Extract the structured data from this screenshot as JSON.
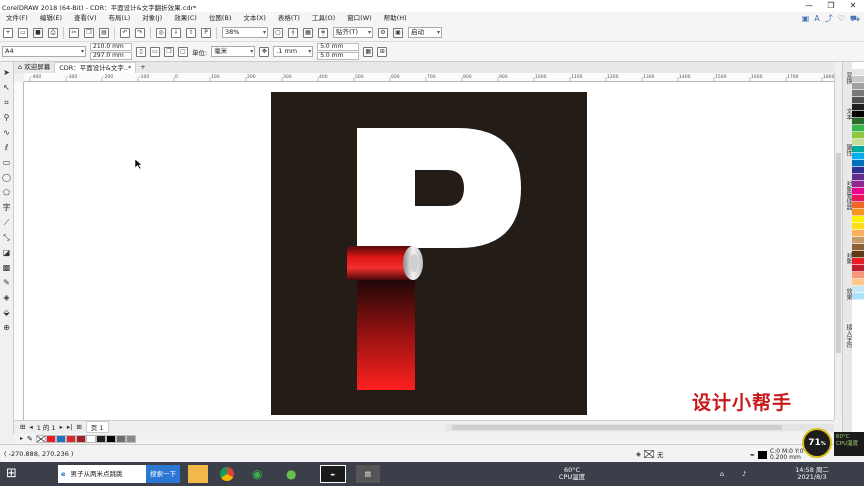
{
  "window": {
    "title": "CorelDRAW 2018 (64-Bit) - CDR：平面设计&文字翻折效果.cdr*",
    "controls": [
      "—",
      "❐",
      "✕"
    ]
  },
  "menu": {
    "items": [
      "文件(F)",
      "编辑(E)",
      "查看(V)",
      "布局(L)",
      "对象(J)",
      "效果(C)",
      "位图(B)",
      "文本(X)",
      "表格(T)",
      "工具(O)",
      "窗口(W)",
      "帮助(H)"
    ]
  },
  "toolbar": {
    "zoom": "38%",
    "snap_label": "贴齐(T)",
    "launch_label": "启动"
  },
  "propertybar": {
    "paper": "A4",
    "width": "210.0 mm",
    "height": "297.0 mm",
    "units_label": "单位:",
    "units": "毫米",
    "nudge": ".1 mm",
    "dup_x": "5.0 mm",
    "dup_y": "5.0 mm"
  },
  "tabs": [
    {
      "label": "欢迎屏幕"
    },
    {
      "label": "CDR：平面设计&文字..*"
    }
  ],
  "ruler": {
    "ticks": [
      "-400",
      "-300",
      "-200",
      "-100",
      "0",
      "100",
      "200",
      "300",
      "400",
      "500",
      "600",
      "700",
      "800",
      "900",
      "1000",
      "1100",
      "1200",
      "1300",
      "1400",
      "1500",
      "1600",
      "1700",
      "1800"
    ]
  },
  "watermark": "设计小帮手",
  "dockers": [
    "变换",
    "文本",
    "属性",
    "对象管理器",
    "对象",
    "效果",
    "插入字符"
  ],
  "palette": [
    "#ffffff",
    "#e6e6e6",
    "#c8c8c8",
    "#a0a0a0",
    "#787878",
    "#505050",
    "#1e1e1e",
    "#000000",
    "#2a6a2a",
    "#39b54a",
    "#8dc63f",
    "#c4df9b",
    "#00a99d",
    "#00aeef",
    "#0072bc",
    "#2e3192",
    "#662d91",
    "#92278f",
    "#ec008c",
    "#ed145b",
    "#f26522",
    "#f7941d",
    "#fff200",
    "#ffde17",
    "#fbaf5d",
    "#c69c6d",
    "#8c6239",
    "#603913",
    "#ed1c24",
    "#be1e2d",
    "#f7977a",
    "#fdc68a",
    "#c6e6f8",
    "#abe1fa"
  ],
  "pagebar": {
    "page_info": "1 的 1",
    "page_tab": "页 1"
  },
  "doc_palette": [
    "#ed1c24",
    "#1c75bc",
    "#d7282f",
    "#9e1f24",
    "#ffffff",
    "#231f20",
    "#000000",
    "#6d6e71",
    "#8a8a8a"
  ],
  "statusbar": {
    "coords": "( -270.888, 270.236 )",
    "fill_label": "无",
    "stroke_label": "C:0 M:0 Y:0 K:100",
    "stroke_size": "0.200 mm"
  },
  "taskbar": {
    "search_text": "男子从两米点跳跳",
    "search_button": "搜索一下",
    "cpu_temp": "60°C",
    "cpu_label": "CPU温度",
    "time": "14:58 周二",
    "date": "2021/8/3"
  },
  "gauge": {
    "value": "71",
    "unit": "%"
  },
  "netwidget": {
    "line1": "60°C",
    "line2": "CPU温度"
  },
  "colors": {
    "artboard_bg": "#231c17",
    "letter_white": "#ffffff",
    "ribbon_red": "#e81c1c",
    "watermark_red": "#c81a1a"
  }
}
